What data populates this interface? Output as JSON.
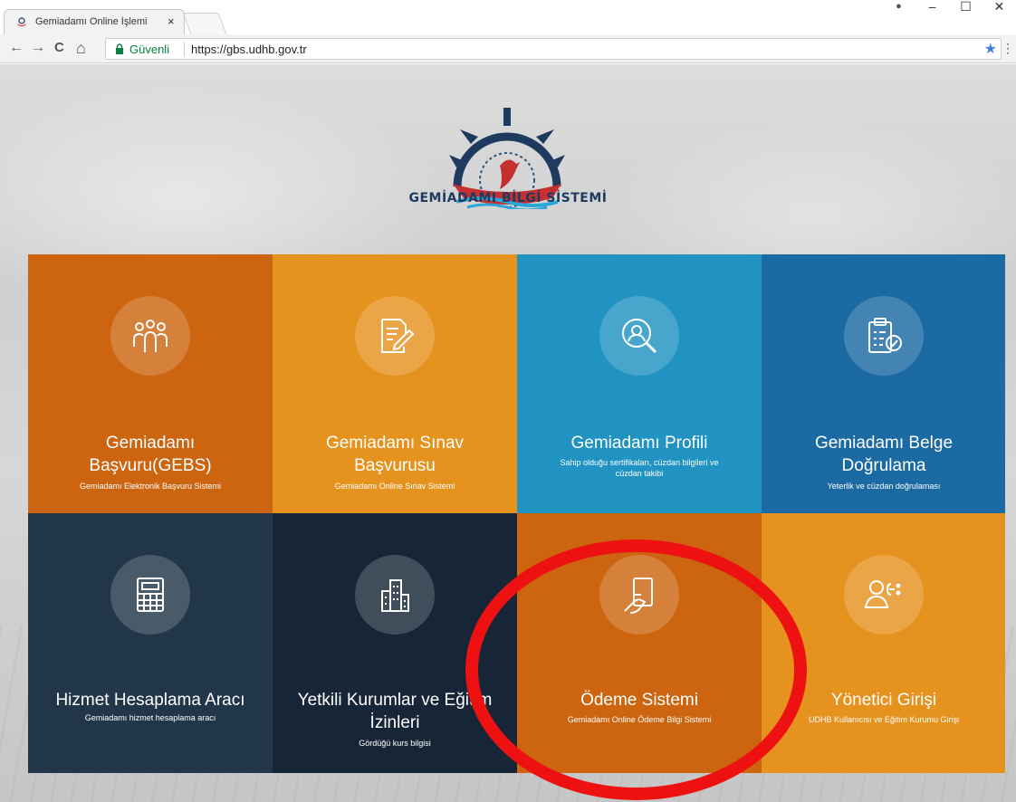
{
  "browser": {
    "tab_title": "Gemiadamı Online İşlemi",
    "tab_close": "×",
    "back": "←",
    "forward": "→",
    "reload": "C",
    "home": "⌂",
    "secure_label": "Güvenli",
    "url": "https://gbs.udhb.gov.tr",
    "window_controls": {
      "profile": "●",
      "minimize": "–",
      "maximize": "☐",
      "close": "✕"
    }
  },
  "header": {
    "logo_text": "GEMİADAMI BİLGİ SİSTEMİ"
  },
  "tiles": [
    {
      "title": "Gemiadamı Başvuru(GEBS)",
      "title_lines": [
        "Gemiadamı",
        "Başvuru(GEBS)"
      ],
      "subtitle": "Gemiadamı Elektronik Başvuru Sistemi",
      "icon": "people-group-icon",
      "color": "#cc6410"
    },
    {
      "title": "Gemiadamı Sınav Başvurusu",
      "title_lines": [
        "Gemiadamı Sınav",
        "Başvurusu"
      ],
      "subtitle": "Gemiadamı Online Sınav Sistemi",
      "icon": "document-edit-icon",
      "color": "#e6921e"
    },
    {
      "title": "Gemiadamı Profili",
      "title_lines": [
        "Gemiadamı Profili"
      ],
      "subtitle_lines": [
        "Sahip olduğu sertifikaları, cüzdan bilgileri ve",
        "cüzdan takibi"
      ],
      "icon": "profile-search-icon",
      "color": "#2093c3"
    },
    {
      "title": "Gemiadamı Belge Doğrulama",
      "title_lines": [
        "Gemiadamı Belge",
        "Doğrulama"
      ],
      "subtitle": "Yeterlik ve cüzdan doğrulaması",
      "icon": "clipboard-check-icon",
      "color": "#1c6aa3"
    },
    {
      "title": "Hizmet Hesaplama Aracı",
      "title_lines": [
        "Hizmet Hesaplama Aracı"
      ],
      "subtitle": "Gemiadamı hizmet hesaplama aracı",
      "icon": "calculator-icon",
      "color": "#213648"
    },
    {
      "title": "Yetkili Kurumlar ve Eğitim İzinleri",
      "title_lines": [
        "Yetkili Kurumlar ve Eğitim",
        "İzinleri"
      ],
      "subtitle": "Gördüğü kurs bilgisi",
      "icon": "buildings-icon",
      "color": "#172636"
    },
    {
      "title": "Ödeme Sistemi",
      "title_lines": [
        "Ödeme Sistemi"
      ],
      "subtitle": "Gemiadamı Online Ödeme Bilgi Sistemi",
      "icon": "payment-hand-icon",
      "color": "#cc6410"
    },
    {
      "title": "Yönetici Girişi",
      "title_lines": [
        "Yönetici Girişi"
      ],
      "subtitle": "UDHB Kullanıcısı ve Eğitim Kurumu Girişi",
      "icon": "admin-users-icon",
      "color": "#e6921e"
    }
  ],
  "annotation": {
    "highlight_color": "#ee1111"
  }
}
